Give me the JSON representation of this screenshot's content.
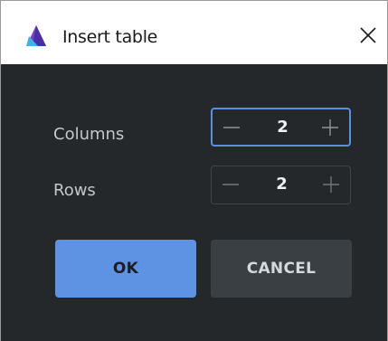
{
  "dialog": {
    "title": "Insert table",
    "app_icon": "triangle-logo-icon",
    "close_icon": "close-icon"
  },
  "fields": {
    "columns": {
      "label": "Columns",
      "value": "2"
    },
    "rows": {
      "label": "Rows",
      "value": "2"
    }
  },
  "buttons": {
    "ok_label": "OK",
    "cancel_label": "CANCEL"
  },
  "colors": {
    "accent": "#5e93e3",
    "focus_border": "#5b8fe0",
    "background": "#24282b",
    "secondary_button": "#3a3f44",
    "logo_purple": "#7b3fc4",
    "logo_cyan": "#3ab6e8"
  }
}
